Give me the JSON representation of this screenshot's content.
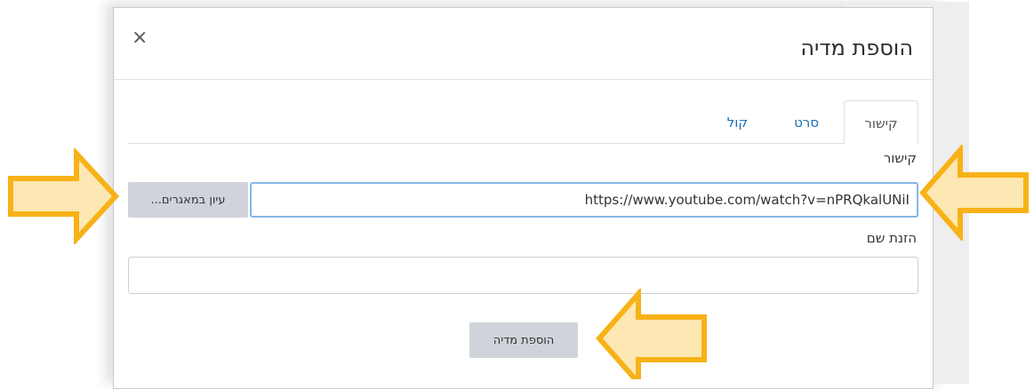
{
  "dialog": {
    "title": "הוספת מדיה",
    "close_symbol": "×"
  },
  "tabs": [
    {
      "label": "קישור",
      "active": true
    },
    {
      "label": "סרט",
      "active": false
    },
    {
      "label": "קול",
      "active": false
    }
  ],
  "link_field": {
    "label": "קישור",
    "value": "https://www.youtube.com/watch?v=nPRQkalUNiI",
    "browse_label": "עיון במאגרים..."
  },
  "name_field": {
    "label": "הזנת שם",
    "value": ""
  },
  "submit_label": "הוספת מדיה",
  "colors": {
    "arrow_fill": "#fde7b2",
    "arrow_stroke": "#f7b217",
    "link_color": "#1a6db3"
  },
  "icons": {
    "close": "close-icon",
    "annotation": "arrow-icon"
  }
}
